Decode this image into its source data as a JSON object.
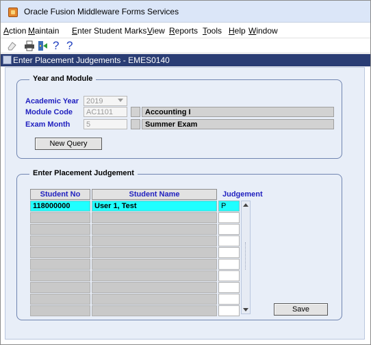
{
  "window": {
    "title": "Oracle Fusion Middleware Forms Services"
  },
  "menu": [
    {
      "label": "Action",
      "u": "A"
    },
    {
      "label": "Maintain",
      "u": "M"
    },
    {
      "label": "Enter Student Marks",
      "u": "E"
    },
    {
      "label": "View",
      "u": "V"
    },
    {
      "label": "Reports",
      "u": "R"
    },
    {
      "label": "Tools",
      "u": "T"
    },
    {
      "label": "Help",
      "u": "H"
    },
    {
      "label": "Window",
      "u": "W"
    }
  ],
  "toolbar": {
    "icons": [
      "eraser-icon",
      "print-icon",
      "exit-icon",
      "help-icon",
      "help-icon"
    ],
    "help_glyph": "?"
  },
  "form": {
    "title": "Enter Placement Judgements - EMES0140"
  },
  "year_module": {
    "legend": "Year and Module",
    "academic_year_label": "Academic Year",
    "academic_year_value": "2019",
    "module_code_label": "Module Code",
    "module_code_value": "AC1101",
    "module_name": "Accounting I",
    "exam_month_label": "Exam Month",
    "exam_month_value": "5",
    "exam_month_name": "Summer Exam",
    "new_query_label": "New Query"
  },
  "placement": {
    "legend": "Enter Placement Judgement",
    "columns": {
      "student_no": "Student No",
      "student_name": "Student Name",
      "judgement": "Judgement"
    },
    "rows": [
      {
        "student_no": "118000000",
        "student_name": "User 1, Test",
        "judgement": "P"
      }
    ],
    "empty_rows": 9,
    "save_label": "Save"
  },
  "colors": {
    "header": "#2a3d74",
    "label": "#1f1fbf",
    "active_row": "#20ffff"
  }
}
